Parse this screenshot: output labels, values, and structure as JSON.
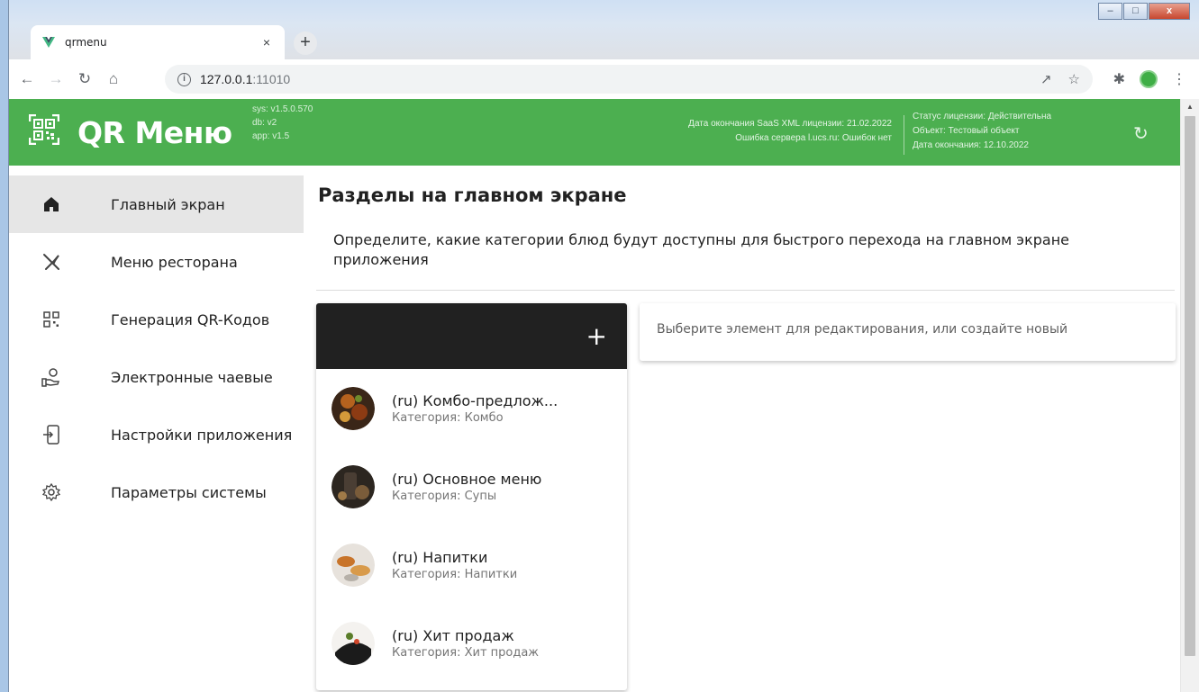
{
  "browser": {
    "tab_title": "qrmenu",
    "tab_close": "×",
    "new_tab": "+",
    "url_host": "127.0.0.1",
    "url_port": ":11010"
  },
  "header": {
    "app_title": "QR Меню",
    "versions": [
      "sys: v1.5.0.570",
      "db: v2",
      "app: v1.5"
    ],
    "license_left": [
      "Дата окончания SaaS XML лицензии: 21.02.2022",
      "Ошибка сервера l.ucs.ru: Ошибок нет"
    ],
    "license_right": [
      "Статус лицензии: Действительна",
      "Объект: Тестовый объект",
      "Дата окончания: 12.10.2022"
    ],
    "brand_color": "#4caf50"
  },
  "sidebar": {
    "items": [
      {
        "label": "Главный экран",
        "icon": "home-icon",
        "active": true
      },
      {
        "label": "Меню ресторана",
        "icon": "cutlery-icon",
        "active": false
      },
      {
        "label": "Генерация QR-Кодов",
        "icon": "qr-code-icon",
        "active": false
      },
      {
        "label": "Электронные чаевые",
        "icon": "tip-hand-icon",
        "active": false
      },
      {
        "label": "Настройки приложения",
        "icon": "app-settings-icon",
        "active": false
      },
      {
        "label": "Параметры системы",
        "icon": "gear-icon",
        "active": false
      }
    ]
  },
  "main": {
    "title": "Разделы на главном экране",
    "description": "Определите, какие категории блюд будут доступны для быстрого перехода на главном экране приложения",
    "add_button": "+",
    "edit_placeholder": "Выберите элемент для редактирования, или создайте новый",
    "items": [
      {
        "title": "(ru) Комбо-предлож...",
        "subtitle": "Категория: Комбо"
      },
      {
        "title": "(ru) Основное меню",
        "subtitle": "Категория: Супы"
      },
      {
        "title": "(ru) Напитки",
        "subtitle": "Категория: Напитки"
      },
      {
        "title": "(ru) Хит продаж",
        "subtitle": "Категория: Хит продаж"
      }
    ]
  }
}
